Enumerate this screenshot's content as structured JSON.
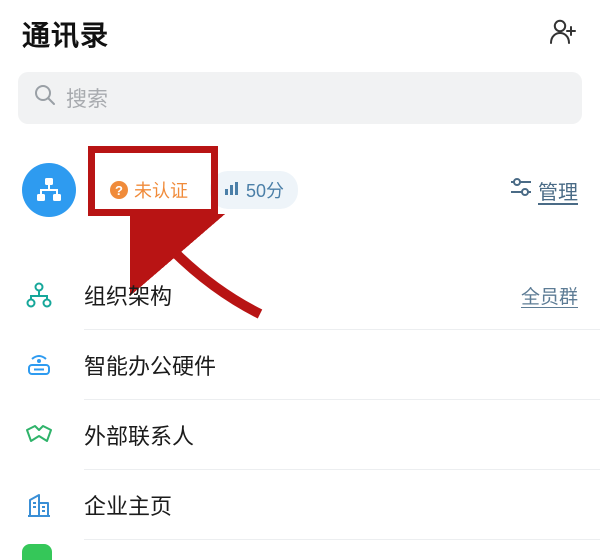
{
  "header": {
    "title": "通讯录"
  },
  "search": {
    "placeholder": "搜索"
  },
  "org": {
    "unverified_label": "未认证",
    "score_label": "50分",
    "manage_label": "管理"
  },
  "list": {
    "items": [
      {
        "label": "组织架构",
        "right": "全员群"
      },
      {
        "label": "智能办公硬件"
      },
      {
        "label": "外部联系人"
      },
      {
        "label": "企业主页"
      }
    ]
  }
}
